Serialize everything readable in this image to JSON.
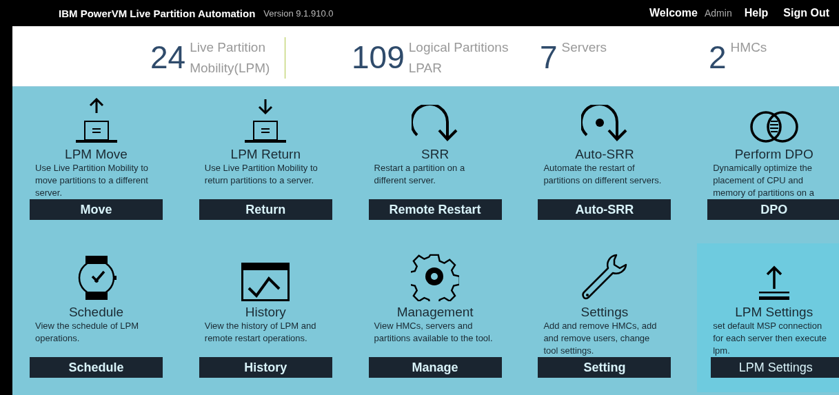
{
  "header": {
    "title": "IBM PowerVM Live Partition Automation",
    "version": "Version 9.1.910.0",
    "welcome": "Welcome",
    "user": "Admin",
    "links": [
      "Help",
      "Sign Out"
    ]
  },
  "stats": [
    {
      "value": "24",
      "label_lines": [
        "Live Partition",
        "Mobility(LPM)"
      ],
      "divider": true
    },
    {
      "value": "109",
      "label_lines": [
        "Logical Partitions",
        "LPAR"
      ],
      "divider": false
    },
    {
      "value": "7",
      "label_lines": [
        "Servers"
      ],
      "divider": false
    },
    {
      "value": "2",
      "label_lines": [
        "HMCs"
      ],
      "divider": false
    }
  ],
  "tiles": [
    {
      "kind": "upload",
      "title": "LPM Move",
      "description": "Use Live Partition Mobility to move partitions to a different server.",
      "button": "Move",
      "highlighted": false
    },
    {
      "kind": "download",
      "title": "LPM Return",
      "description": "Use Live Partition Mobility to return partitions to a server.",
      "button": "Return",
      "highlighted": false
    },
    {
      "kind": "restart",
      "title": "SRR",
      "description": "Restart a partition on a different server.",
      "button": "Remote Restart",
      "highlighted": false
    },
    {
      "kind": "auto-restart",
      "title": "Auto-SRR",
      "description": "Automate the restart of partitions on different servers.",
      "button": "Auto-SRR",
      "highlighted": false
    },
    {
      "kind": "circles",
      "title": "Perform DPO",
      "description": "Dynamically optimize the placement of CPU and memory of partitions on a",
      "button": "DPO",
      "highlighted": false
    },
    {
      "kind": "watch",
      "title": "Schedule",
      "description": "View the schedule of LPM operations.",
      "button": "Schedule",
      "highlighted": false
    },
    {
      "kind": "chart",
      "title": "History",
      "description": "View the history of LPM and remote restart operations.",
      "button": "History",
      "highlighted": false
    },
    {
      "kind": "gear",
      "title": "Management",
      "description": "View HMCs, servers and partitions available to the tool.",
      "button": "Manage",
      "highlighted": false
    },
    {
      "kind": "wrench",
      "title": "Settings",
      "description": "Add and remove HMCs, add and remove users, change tool settings.",
      "button": "Setting",
      "highlighted": false
    },
    {
      "kind": "export",
      "title": "LPM Settings",
      "description": "set default MSP connection for each server then execute lpm.",
      "button": "LPM Settings",
      "highlighted": true
    }
  ]
}
